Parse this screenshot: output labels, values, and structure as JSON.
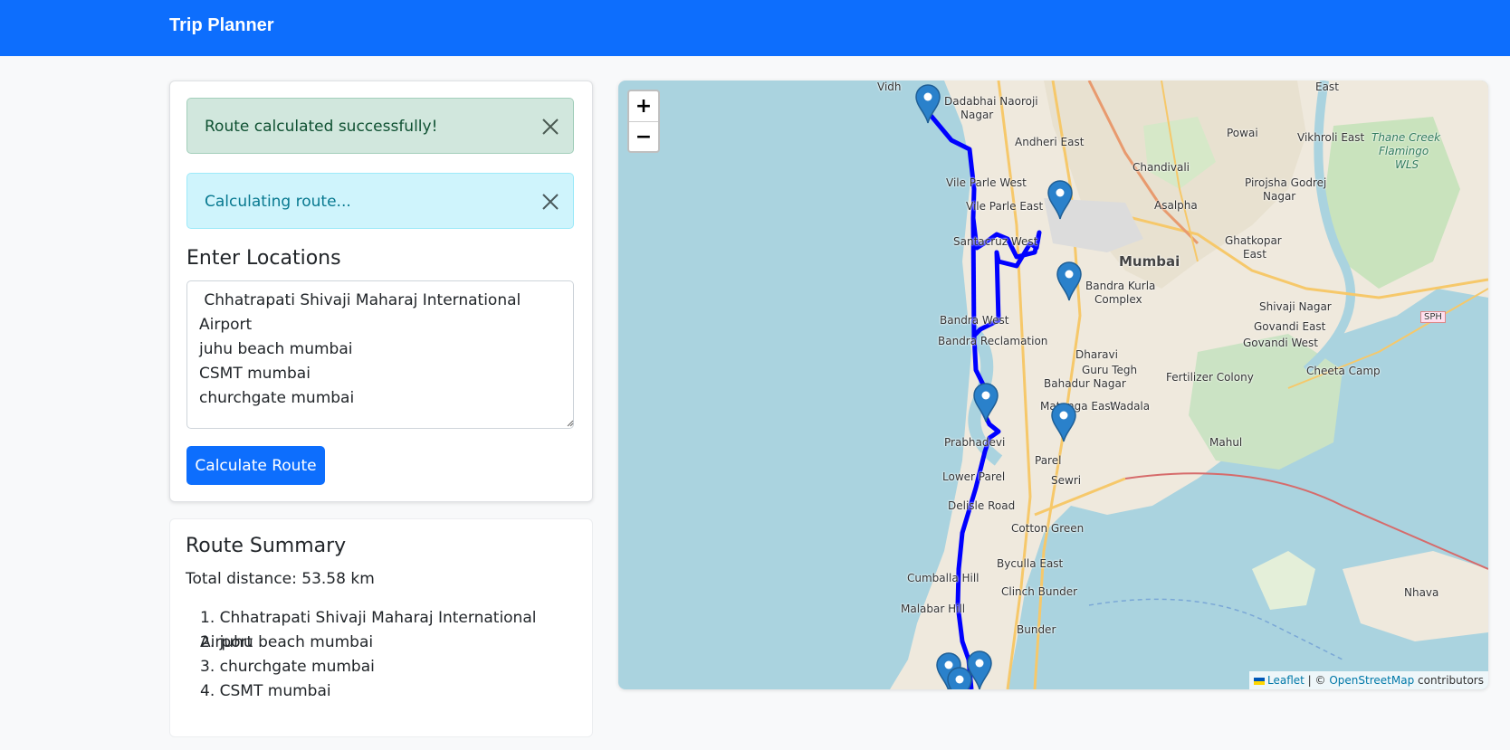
{
  "app": {
    "title": "Trip Planner"
  },
  "alerts": [
    {
      "text": "Route calculated successfully!",
      "type": "success"
    },
    {
      "text": "Calculating route...",
      "type": "info"
    }
  ],
  "form": {
    "title": "Enter Locations",
    "locations_value": " Chhatrapati Shivaji Maharaj International Airport\njuhu beach mumbai\nCSMT mumbai\nchurchgate mumbai",
    "button_label": "Calculate Route"
  },
  "summary": {
    "title": "Route Summary",
    "distance_text": "Total distance: 53.58 km",
    "stops": [
      "Chhatrapati Shivaji Maharaj International Airport",
      "juhu beach mumbai",
      "churchgate mumbai",
      "CSMT mumbai"
    ],
    "stop_numbers": [
      "1.",
      "2.",
      "3.",
      "4."
    ]
  },
  "map": {
    "zoom_in": "+",
    "zoom_out": "−",
    "attribution": {
      "leaflet": "Leaflet",
      "sep": " | © ",
      "osm": "OpenStreetMap",
      "suffix": " contributors"
    },
    "route_color": "#0000ff",
    "marker_color": "#2a81cb",
    "labels": [
      "Dadabhai Naoroji",
      "Nagar",
      "Andheri East",
      "Powai",
      "Vikhroli East",
      "Thane Creek",
      "Flamingo",
      "WLS",
      "Vile Parle West",
      "Chandivali",
      "Pirojsha Godrej",
      "Nagar",
      "Vile Parle East",
      "Asalpha",
      "Ghatkopar",
      "East",
      "Santacruz West",
      "Mumbai",
      "Bandra Kurla",
      "Complex",
      "Shivaji Nagar",
      "Govandi East",
      "Govandi West",
      "Bandra West",
      "Bandra Reclamation",
      "Dharavi",
      "Guru Tegh",
      "Bahadur Nagar",
      "Fertilizer Colony",
      "Cheeta Camp",
      "Matunga East",
      "Wadala",
      "Prabhadevi",
      "Parel",
      "Mahul",
      "Lower Parel",
      "Sewri",
      "Delisle Road",
      "Cotton Green",
      "Byculla East",
      "Cumballa Hill",
      "Clinch Bunder",
      "Malabar Hill",
      "Nhava",
      "SPH",
      "East",
      "Vidh",
      "Bunder"
    ]
  }
}
